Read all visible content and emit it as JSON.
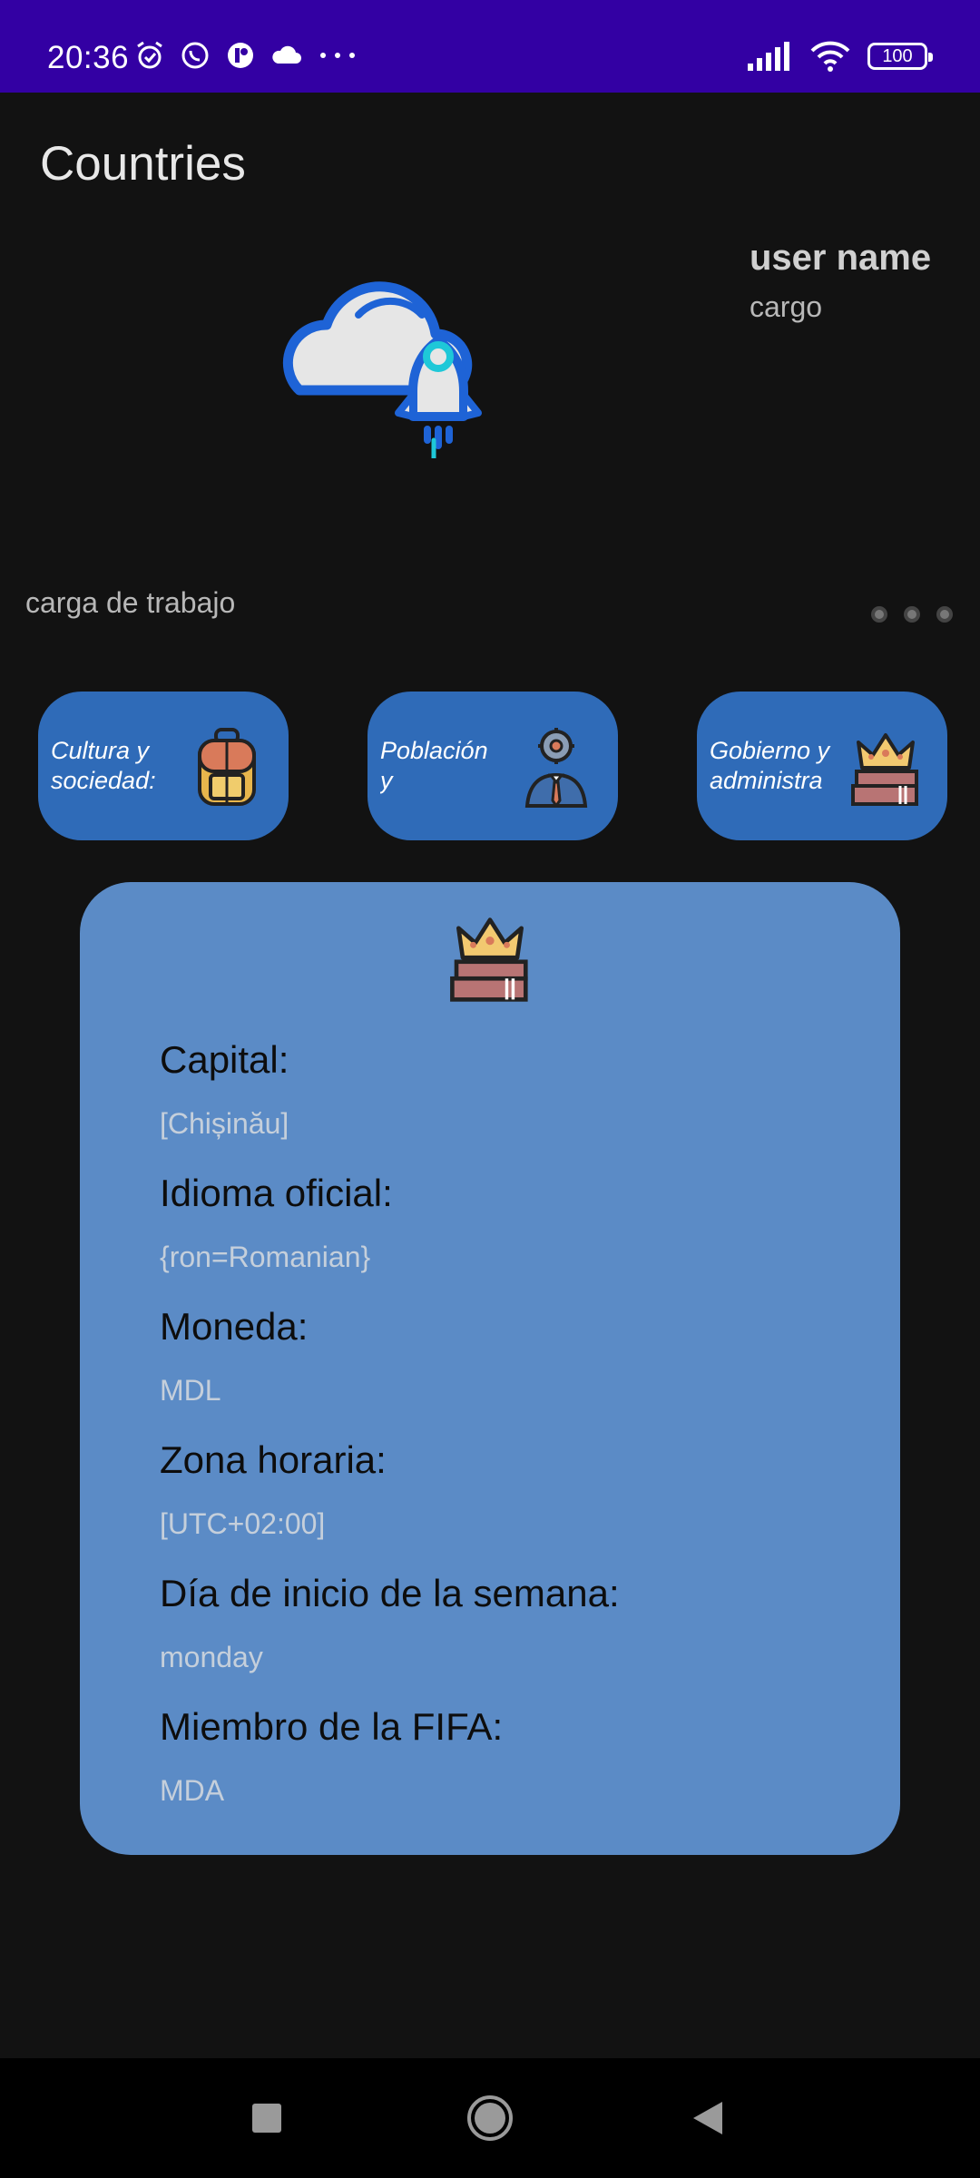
{
  "status_bar": {
    "time": "20:36",
    "battery": "100",
    "left_icons": [
      "alarm-icon",
      "whatsapp-icon",
      "app-icon",
      "cloud-icon",
      "more-dots-icon"
    ],
    "right_icons": [
      "signal-icon",
      "wifi-icon",
      "battery-icon"
    ],
    "background_color": "#3300a3"
  },
  "app": {
    "title": "Countries"
  },
  "header": {
    "user_name": "user name",
    "user_role": "cargo",
    "workload_label": "carga de trabajo",
    "logo_icon": "cloud-rocket-icon"
  },
  "categories": [
    {
      "label": "Cultura y\nsociedad:",
      "icon": "backpack-icon"
    },
    {
      "label": "Población\ny",
      "icon": "businessman-gear-icon"
    },
    {
      "label": "Gobierno y\nadministra",
      "icon": "crown-books-icon"
    }
  ],
  "card": {
    "icon": "crown-books-icon",
    "fields": [
      {
        "label": "Capital:",
        "value": "[Chișinău]"
      },
      {
        "label": "Idioma oficial:",
        "value": "{ron=Romanian}"
      },
      {
        "label": "Moneda:",
        "value": "MDL"
      },
      {
        "label": "Zona horaria:",
        "value": "[UTC+02:00]"
      },
      {
        "label": "Día de inicio de la semana:",
        "value": "monday"
      },
      {
        "label": "Miembro de la FIFA:",
        "value": "MDA"
      }
    ],
    "background_color": "#5b8bc6"
  },
  "nav_bar": {
    "buttons": [
      "recents-square-icon",
      "home-circle-icon",
      "back-triangle-icon"
    ]
  },
  "colors": {
    "background": "#121212",
    "category_button": "#2f6bb8",
    "accent_blue": "#1e63d6"
  }
}
